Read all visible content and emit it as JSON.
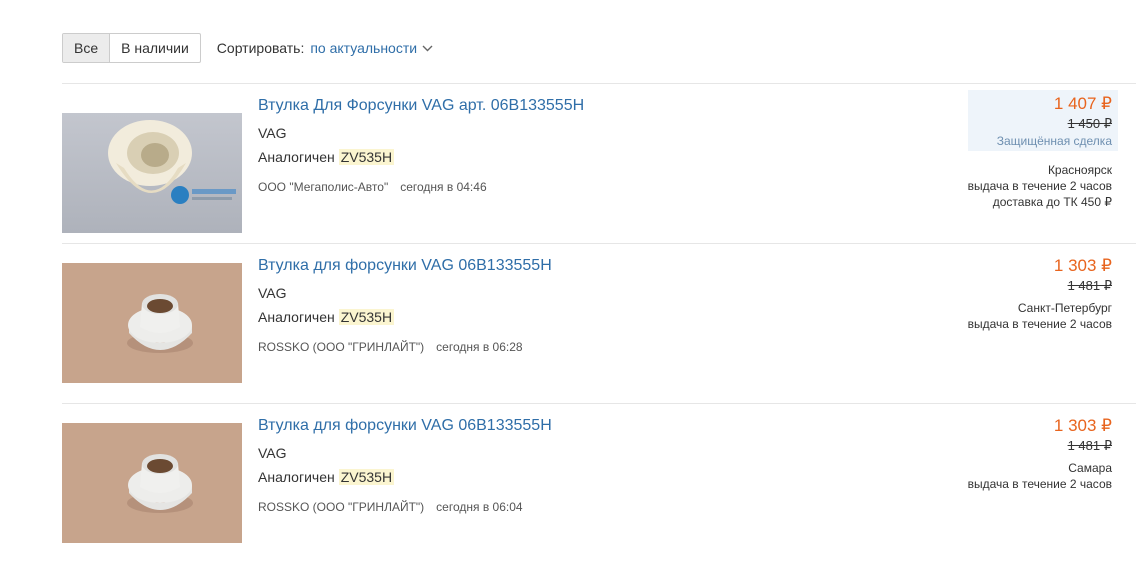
{
  "filters": {
    "all": "Все",
    "in_stock": "В наличии"
  },
  "sort": {
    "label": "Сортировать:",
    "value": "по актуальности"
  },
  "items": [
    {
      "title": "Втулка Для Форсунки VAG арт. 06B133555H",
      "brand": "VAG",
      "analog_label": "Аналогичен",
      "analog_code": "ZV535H",
      "seller": "ООО \"Мегаполис-Авто\"",
      "time": "сегодня в 04:46",
      "price": "1 407 ₽",
      "old_price": "1 450 ₽",
      "deal": "Защищённая сделка",
      "city": "Красноярск",
      "delivery": "выдача в течение 2 часов",
      "shipping": "доставка до ТК 450 ₽"
    },
    {
      "title": "Втулка для форсунки VAG 06B133555H",
      "brand": "VAG",
      "analog_label": "Аналогичен",
      "analog_code": "ZV535H",
      "seller": "ROSSKO (ООО \"ГРИНЛАЙТ\")",
      "time": "сегодня в 06:28",
      "price": "1 303 ₽",
      "old_price": "1 481 ₽",
      "city": "Санкт-Петербург",
      "delivery": "выдача в течение 2 часов"
    },
    {
      "title": "Втулка для форсунки VAG 06B133555H",
      "brand": "VAG",
      "analog_label": "Аналогичен",
      "analog_code": "ZV535H",
      "seller": "ROSSKO (ООО \"ГРИНЛАЙТ\")",
      "time": "сегодня в 06:04",
      "price": "1 303 ₽",
      "old_price": "1 481 ₽",
      "city": "Самара",
      "delivery": "выдача в течение 2 часов"
    }
  ],
  "colors": {
    "link": "#2f6ea8",
    "price": "#e8641e",
    "highlight": "#fbf5d0"
  }
}
